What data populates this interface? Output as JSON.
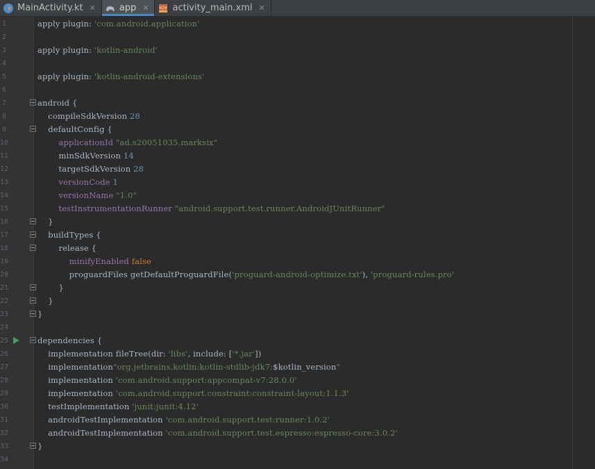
{
  "tabs": [
    {
      "label": "MainActivity.kt",
      "icon": "kotlin-file-icon",
      "active": false
    },
    {
      "label": "app",
      "icon": "gradle-elephant-icon",
      "active": true
    },
    {
      "label": "activity_main.xml",
      "icon": "xml-layout-icon",
      "active": false
    }
  ],
  "colors": {
    "string": "#6a8759",
    "number": "#6897bb",
    "keyword": "#cc7832",
    "property": "#9876aa",
    "text": "#a9b7c6"
  },
  "lines": [
    {
      "n": "1",
      "tokens": [
        [
          "apply plugin: ",
          "t"
        ],
        [
          "'com.android.application'",
          "s"
        ]
      ]
    },
    {
      "n": "2",
      "tokens": []
    },
    {
      "n": "3",
      "tokens": [
        [
          "apply plugin: ",
          "t"
        ],
        [
          "'kotlin-android'",
          "s"
        ]
      ]
    },
    {
      "n": "4",
      "tokens": []
    },
    {
      "n": "5",
      "tokens": [
        [
          "apply plugin: ",
          "t"
        ],
        [
          "'kotlin-android-extensions'",
          "s"
        ]
      ]
    },
    {
      "n": "6",
      "tokens": []
    },
    {
      "n": "7",
      "fold": true,
      "tokens": [
        [
          "android {",
          "t"
        ]
      ]
    },
    {
      "n": "8",
      "tokens": [
        [
          "    compileSdkVersion ",
          "t"
        ],
        [
          "28",
          "n"
        ]
      ]
    },
    {
      "n": "9",
      "fold": true,
      "tokens": [
        [
          "    defaultConfig {",
          "t"
        ]
      ]
    },
    {
      "n": "10",
      "tokens": [
        [
          "        ",
          "t"
        ],
        [
          "applicationId",
          "p"
        ],
        [
          " ",
          "t"
        ],
        [
          "\"ad.s20051035.marksix\"",
          "s"
        ]
      ]
    },
    {
      "n": "11",
      "tokens": [
        [
          "        minSdkVersion ",
          "t"
        ],
        [
          "14",
          "n"
        ]
      ]
    },
    {
      "n": "12",
      "tokens": [
        [
          "        targetSdkVersion ",
          "t"
        ],
        [
          "28",
          "n"
        ]
      ]
    },
    {
      "n": "13",
      "tokens": [
        [
          "        ",
          "t"
        ],
        [
          "versionCode",
          "p"
        ],
        [
          " ",
          "t"
        ],
        [
          "1",
          "n"
        ]
      ]
    },
    {
      "n": "14",
      "tokens": [
        [
          "        ",
          "t"
        ],
        [
          "versionName",
          "p"
        ],
        [
          " ",
          "t"
        ],
        [
          "\"1.0\"",
          "s"
        ]
      ]
    },
    {
      "n": "15",
      "tokens": [
        [
          "        ",
          "t"
        ],
        [
          "testInstrumentationRunner",
          "p"
        ],
        [
          " ",
          "t"
        ],
        [
          "\"android.support.test.runner.AndroidJUnitRunner\"",
          "s"
        ]
      ]
    },
    {
      "n": "16",
      "fold": true,
      "tokens": [
        [
          "    }",
          "t"
        ]
      ]
    },
    {
      "n": "17",
      "fold": true,
      "tokens": [
        [
          "    buildTypes {",
          "t"
        ]
      ]
    },
    {
      "n": "18",
      "fold": true,
      "tokens": [
        [
          "        release {",
          "t"
        ]
      ]
    },
    {
      "n": "19",
      "tokens": [
        [
          "            ",
          "t"
        ],
        [
          "minifyEnabled",
          "p"
        ],
        [
          " ",
          "t"
        ],
        [
          "false",
          "k"
        ]
      ]
    },
    {
      "n": "20",
      "tokens": [
        [
          "            proguardFiles getDefaultProguardFile(",
          "t"
        ],
        [
          "'proguard-android-optimize.txt'",
          "s"
        ],
        [
          "), ",
          "t"
        ],
        [
          "'proguard-rules.pro'",
          "s"
        ]
      ]
    },
    {
      "n": "21",
      "fold": true,
      "tokens": [
        [
          "        }",
          "t"
        ]
      ]
    },
    {
      "n": "22",
      "fold": true,
      "tokens": [
        [
          "    }",
          "t"
        ]
      ]
    },
    {
      "n": "23",
      "fold": true,
      "tokens": [
        [
          "}",
          "t"
        ]
      ]
    },
    {
      "n": "24",
      "tokens": []
    },
    {
      "n": "25",
      "fold": true,
      "run": true,
      "tokens": [
        [
          "dependencies {",
          "t"
        ]
      ]
    },
    {
      "n": "26",
      "tokens": [
        [
          "    implementation fileTree(dir: ",
          "t"
        ],
        [
          "'libs'",
          "s"
        ],
        [
          ", include: [",
          "t"
        ],
        [
          "'*.jar'",
          "s"
        ],
        [
          "])",
          "t"
        ]
      ]
    },
    {
      "n": "27",
      "tokens": [
        [
          "    implementation",
          "t"
        ],
        [
          "\"org.jetbrains.kotlin:kotlin-stdlib-jdk7:",
          "s"
        ],
        [
          "$kotlin_version",
          "t"
        ],
        [
          "\"",
          "s"
        ]
      ]
    },
    {
      "n": "28",
      "tokens": [
        [
          "    implementation ",
          "t"
        ],
        [
          "'com.android.support:appcompat-v7:28.0.0'",
          "s"
        ]
      ]
    },
    {
      "n": "29",
      "tokens": [
        [
          "    implementation ",
          "t"
        ],
        [
          "'com.android.support.constraint:constraint-layout:1.1.3'",
          "s"
        ]
      ]
    },
    {
      "n": "30",
      "tokens": [
        [
          "    testImplementation ",
          "t"
        ],
        [
          "'junit:junit:4.12'",
          "s"
        ]
      ]
    },
    {
      "n": "31",
      "tokens": [
        [
          "    androidTestImplementation ",
          "t"
        ],
        [
          "'com.android.support.test:runner:1.0.2'",
          "s"
        ]
      ]
    },
    {
      "n": "32",
      "tokens": [
        [
          "    androidTestImplementation ",
          "t"
        ],
        [
          "'com.android.support.test.espresso:espresso-core:3.0.2'",
          "s"
        ]
      ]
    },
    {
      "n": "33",
      "fold": true,
      "tokens": [
        [
          "}",
          "t"
        ]
      ]
    },
    {
      "n": "34",
      "tokens": []
    }
  ]
}
